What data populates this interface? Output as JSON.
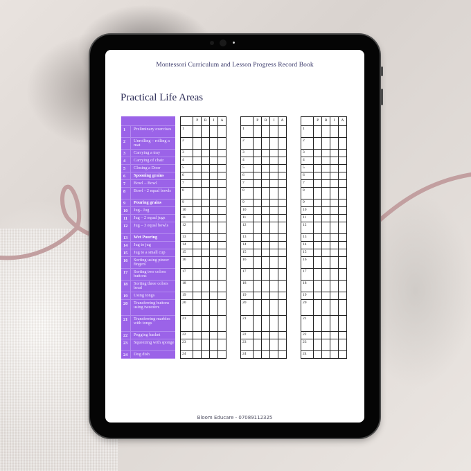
{
  "document": {
    "header": "Montessori Curriculum and Lesson Progress Record Book",
    "title": "Practical Life Areas",
    "footer": "Bloom Educare - 07089112325",
    "accent_color": "#9b63e8",
    "grid_headers": [
      "",
      "P",
      "R",
      "I",
      "A"
    ],
    "grid_count": 3,
    "activities": [
      {
        "num": "1",
        "label": "Preliminary exercises",
        "bold": false,
        "lines": 2
      },
      {
        "num": "2",
        "label": "Unrolling – rolling a mat",
        "bold": false,
        "lines": 2
      },
      {
        "num": "3",
        "label": "Carrying a tray",
        "bold": false,
        "lines": 1
      },
      {
        "num": "4",
        "label": "Carrying of chair",
        "bold": false,
        "lines": 1
      },
      {
        "num": "5",
        "label": "Closing a Door",
        "bold": false,
        "lines": 1
      },
      {
        "num": "6",
        "label": "Spooning grains",
        "bold": true,
        "lines": 1
      },
      {
        "num": "7",
        "label": "Bowl – Bowl",
        "bold": false,
        "lines": 1
      },
      {
        "num": "8",
        "label": "Bowl - 2 equal bowls",
        "bold": false,
        "lines": 2
      },
      {
        "num": "9",
        "label": "Pouring grains",
        "bold": true,
        "lines": 1
      },
      {
        "num": "10",
        "label": "Jug– Jug",
        "bold": false,
        "lines": 1
      },
      {
        "num": "11",
        "label": "Jug – 2 equal jugs",
        "bold": false,
        "lines": 1
      },
      {
        "num": "12",
        "label": "Jug – 3 equal bowls",
        "bold": false,
        "lines": 2
      },
      {
        "num": "13",
        "label": "Wet Pouring",
        "bold": true,
        "lines": 1
      },
      {
        "num": "14",
        "label": "Jug to jug",
        "bold": false,
        "lines": 1
      },
      {
        "num": "15",
        "label": "Jug to a small cup",
        "bold": false,
        "lines": 1
      },
      {
        "num": "16",
        "label": "Sorting using pincer fingers",
        "bold": false,
        "lines": 2
      },
      {
        "num": "17",
        "label": "Sorting two colors buttons",
        "bold": false,
        "lines": 2
      },
      {
        "num": "18",
        "label": "Sorting three colors bead",
        "bold": false,
        "lines": 2
      },
      {
        "num": "19",
        "label": "Using tongs",
        "bold": false,
        "lines": 1
      },
      {
        "num": "20",
        "label": "Transferring buttons using tweezers",
        "bold": false,
        "lines": 3
      },
      {
        "num": "21",
        "label": "Transferring marbles with tongs",
        "bold": false,
        "lines": 3
      },
      {
        "num": "22",
        "label": "Pegging basket",
        "bold": false,
        "lines": 1
      },
      {
        "num": "23",
        "label": "Squeezing with sponge",
        "bold": false,
        "lines": 2
      },
      {
        "num": "24",
        "label": "Dog dish",
        "bold": false,
        "lines": 1
      }
    ]
  }
}
